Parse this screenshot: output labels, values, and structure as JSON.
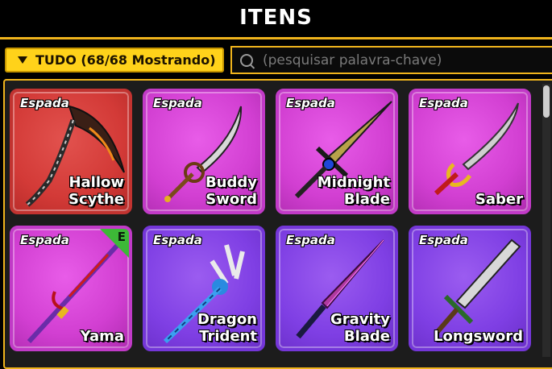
{
  "header": {
    "title": "ITENS"
  },
  "filter": {
    "label": "TUDO (68/68 Mostrando)"
  },
  "search": {
    "placeholder": "(pesquisar palavra-chave)"
  },
  "items": [
    {
      "type": "Espada",
      "name_line1": "Hallow",
      "name_line2": "Scythe",
      "rarity": "red"
    },
    {
      "type": "Espada",
      "name_line1": "Buddy",
      "name_line2": "Sword",
      "rarity": "pink"
    },
    {
      "type": "Espada",
      "name_line1": "Midnight",
      "name_line2": "Blade",
      "rarity": "pink"
    },
    {
      "type": "Espada",
      "name_line1": "",
      "name_line2": "Saber",
      "rarity": "pink"
    },
    {
      "type": "Espada",
      "name_line1": "",
      "name_line2": "Yama",
      "rarity": "pink",
      "equipped_badge": "E"
    },
    {
      "type": "Espada",
      "name_line1": "Dragon",
      "name_line2": "Trident",
      "rarity": "purple"
    },
    {
      "type": "Espada",
      "name_line1": "Gravity",
      "name_line2": "Blade",
      "rarity": "purple"
    },
    {
      "type": "Espada",
      "name_line1": "",
      "name_line2": "Longsword",
      "rarity": "purple"
    }
  ]
}
